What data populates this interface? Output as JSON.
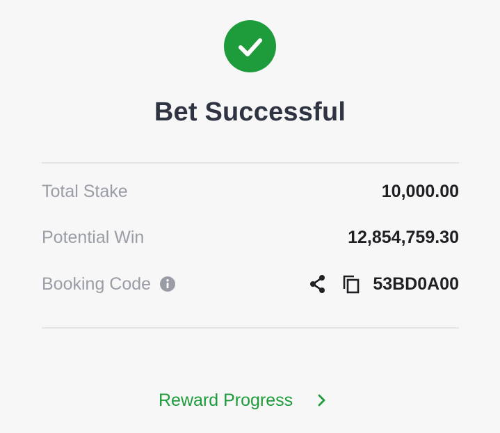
{
  "status": {
    "title": "Bet Successful",
    "icon": "check-circle-icon",
    "accent_color": "#1e9b3b"
  },
  "summary": {
    "total_stake_label": "Total Stake",
    "total_stake_value": "10,000.00",
    "potential_win_label": "Potential Win",
    "potential_win_value": "12,854,759.30",
    "booking_code_label": "Booking Code",
    "booking_code_value": "53BD0A00"
  },
  "icons": {
    "info": "info-icon",
    "share": "share-icon",
    "copy": "copy-icon",
    "chevron": "chevron-right-icon"
  },
  "reward": {
    "label": "Reward Progress"
  }
}
